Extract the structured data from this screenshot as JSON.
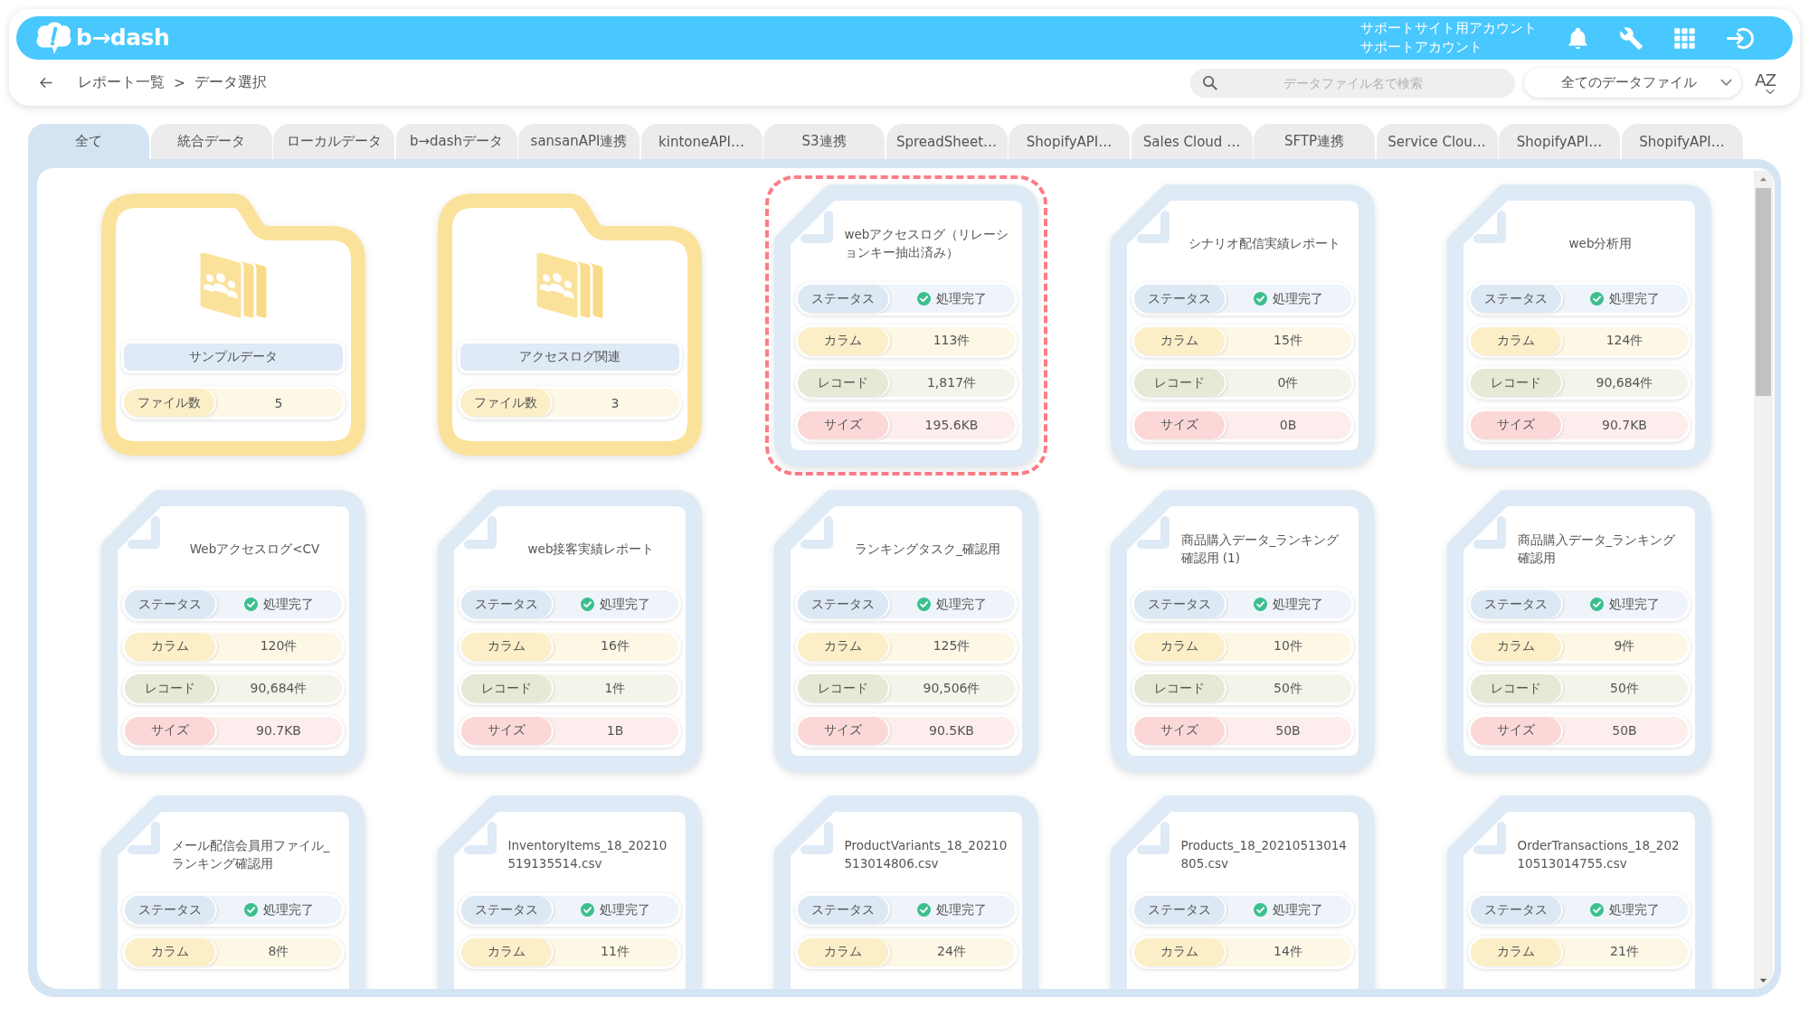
{
  "header": {
    "logo_text": "b→dash",
    "account_lines": [
      "サポートサイト用アカウント",
      "サポートアカウント"
    ]
  },
  "breadcrumb": {
    "items": [
      "レポート一覧",
      "データ選択"
    ],
    "separator": ">"
  },
  "search": {
    "placeholder": "データファイル名で検索"
  },
  "filter": {
    "value": "全てのデータファイル"
  },
  "sort_button": {
    "label": "AZ"
  },
  "tabs": [
    {
      "label": "全て",
      "selected": true
    },
    {
      "label": "統合データ",
      "selected": false
    },
    {
      "label": "ローカルデータ",
      "selected": false
    },
    {
      "label": "b→dashデータ",
      "selected": false
    },
    {
      "label": "sansanAPI連携",
      "selected": false
    },
    {
      "label": "kintoneAPI…",
      "selected": false
    },
    {
      "label": "S3連携",
      "selected": false
    },
    {
      "label": "SpreadSheet…",
      "selected": false
    },
    {
      "label": "ShopifyAPI…",
      "selected": false
    },
    {
      "label": "Sales Cloud …",
      "selected": false
    },
    {
      "label": "SFTP連携",
      "selected": false
    },
    {
      "label": "Service Clou…",
      "selected": false
    },
    {
      "label": "ShopifyAPI…",
      "selected": false
    },
    {
      "label": "ShopifyAPI…",
      "selected": false
    }
  ],
  "cards": [
    {
      "kind": "folder",
      "name": "サンプルデータ",
      "selected": false,
      "stats": [
        {
          "kind": "files",
          "label": "ファイル数",
          "value": "5"
        }
      ]
    },
    {
      "kind": "folder",
      "name": "アクセスログ関連",
      "selected": false,
      "stats": [
        {
          "kind": "files",
          "label": "ファイル数",
          "value": "3"
        }
      ]
    },
    {
      "kind": "file",
      "name": "webアクセスログ（リレーションキー抽出済み）",
      "selected": true,
      "stats": [
        {
          "kind": "status",
          "label": "ステータス",
          "value": "処理完了"
        },
        {
          "kind": "columns",
          "label": "カラム",
          "value": "113件"
        },
        {
          "kind": "records",
          "label": "レコード",
          "value": "1,817件"
        },
        {
          "kind": "size",
          "label": "サイズ",
          "value": "195.6KB"
        }
      ]
    },
    {
      "kind": "file",
      "name": "シナリオ配信実績レポート",
      "selected": false,
      "stats": [
        {
          "kind": "status",
          "label": "ステータス",
          "value": "処理完了"
        },
        {
          "kind": "columns",
          "label": "カラム",
          "value": "15件"
        },
        {
          "kind": "records",
          "label": "レコード",
          "value": "0件"
        },
        {
          "kind": "size",
          "label": "サイズ",
          "value": "0B"
        }
      ]
    },
    {
      "kind": "file",
      "name": "web分析用",
      "selected": false,
      "stats": [
        {
          "kind": "status",
          "label": "ステータス",
          "value": "処理完了"
        },
        {
          "kind": "columns",
          "label": "カラム",
          "value": "124件"
        },
        {
          "kind": "records",
          "label": "レコード",
          "value": "90,684件"
        },
        {
          "kind": "size",
          "label": "サイズ",
          "value": "90.7KB"
        }
      ]
    },
    {
      "kind": "file",
      "name": "Webアクセスログ<CV",
      "selected": false,
      "stats": [
        {
          "kind": "status",
          "label": "ステータス",
          "value": "処理完了"
        },
        {
          "kind": "columns",
          "label": "カラム",
          "value": "120件"
        },
        {
          "kind": "records",
          "label": "レコード",
          "value": "90,684件"
        },
        {
          "kind": "size",
          "label": "サイズ",
          "value": "90.7KB"
        }
      ]
    },
    {
      "kind": "file",
      "name": "web接客実績レポート",
      "selected": false,
      "stats": [
        {
          "kind": "status",
          "label": "ステータス",
          "value": "処理完了"
        },
        {
          "kind": "columns",
          "label": "カラム",
          "value": "16件"
        },
        {
          "kind": "records",
          "label": "レコード",
          "value": "1件"
        },
        {
          "kind": "size",
          "label": "サイズ",
          "value": "1B"
        }
      ]
    },
    {
      "kind": "file",
      "name": "ランキングタスク_確認用",
      "selected": false,
      "stats": [
        {
          "kind": "status",
          "label": "ステータス",
          "value": "処理完了"
        },
        {
          "kind": "columns",
          "label": "カラム",
          "value": "125件"
        },
        {
          "kind": "records",
          "label": "レコード",
          "value": "90,506件"
        },
        {
          "kind": "size",
          "label": "サイズ",
          "value": "90.5KB"
        }
      ]
    },
    {
      "kind": "file",
      "name": "商品購入データ_ランキング確認用 (1)",
      "selected": false,
      "stats": [
        {
          "kind": "status",
          "label": "ステータス",
          "value": "処理完了"
        },
        {
          "kind": "columns",
          "label": "カラム",
          "value": "10件"
        },
        {
          "kind": "records",
          "label": "レコード",
          "value": "50件"
        },
        {
          "kind": "size",
          "label": "サイズ",
          "value": "50B"
        }
      ]
    },
    {
      "kind": "file",
      "name": "商品購入データ_ランキング確認用",
      "selected": false,
      "stats": [
        {
          "kind": "status",
          "label": "ステータス",
          "value": "処理完了"
        },
        {
          "kind": "columns",
          "label": "カラム",
          "value": "9件"
        },
        {
          "kind": "records",
          "label": "レコード",
          "value": "50件"
        },
        {
          "kind": "size",
          "label": "サイズ",
          "value": "50B"
        }
      ]
    },
    {
      "kind": "file",
      "name": "メール配信会員用ファイル_ランキング確認用",
      "selected": false,
      "stats": [
        {
          "kind": "status",
          "label": "ステータス",
          "value": "処理完了"
        },
        {
          "kind": "columns",
          "label": "カラム",
          "value": "8件"
        }
      ]
    },
    {
      "kind": "file",
      "name": "InventoryItems_18_20210519135514.csv",
      "selected": false,
      "stats": [
        {
          "kind": "status",
          "label": "ステータス",
          "value": "処理完了"
        },
        {
          "kind": "columns",
          "label": "カラム",
          "value": "11件"
        }
      ]
    },
    {
      "kind": "file",
      "name": "ProductVariants_18_20210513014806.csv",
      "selected": false,
      "stats": [
        {
          "kind": "status",
          "label": "ステータス",
          "value": "処理完了"
        },
        {
          "kind": "columns",
          "label": "カラム",
          "value": "24件"
        }
      ]
    },
    {
      "kind": "file",
      "name": "Products_18_20210513014805.csv",
      "selected": false,
      "stats": [
        {
          "kind": "status",
          "label": "ステータス",
          "value": "処理完了"
        },
        {
          "kind": "columns",
          "label": "カラム",
          "value": "14件"
        }
      ]
    },
    {
      "kind": "file",
      "name": "OrderTransactions_18_20210513014755.csv",
      "selected": false,
      "stats": [
        {
          "kind": "status",
          "label": "ステータス",
          "value": "処理完了"
        },
        {
          "kind": "columns",
          "label": "カラム",
          "value": "21件"
        }
      ]
    }
  ]
}
